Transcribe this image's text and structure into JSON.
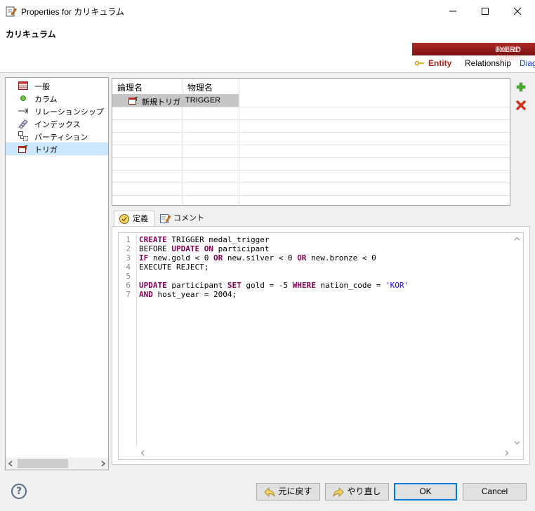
{
  "window": {
    "title": "Properties for カリキュラム"
  },
  "header": {
    "entity_name": "カリキュラム",
    "brand": {
      "exerd": "eXERD",
      "tomato": "Tomato System"
    },
    "tabs": [
      "Entity",
      "Relationship",
      "Diag"
    ]
  },
  "tree": {
    "items": [
      {
        "label": "一般",
        "icon": "table-icon"
      },
      {
        "label": "カラム",
        "icon": "column-dot-icon"
      },
      {
        "label": "リレーションシップ",
        "icon": "relationship-icon"
      },
      {
        "label": "インデックス",
        "icon": "index-icon"
      },
      {
        "label": "パーティション",
        "icon": "partition-icon"
      },
      {
        "label": "トリガ",
        "icon": "trigger-icon",
        "selected": true
      }
    ]
  },
  "grid": {
    "columns": [
      "論理名",
      "物理名"
    ],
    "rows": [
      {
        "logical": "新規トリガ",
        "physical": "TRIGGER"
      }
    ]
  },
  "tabs": [
    {
      "label": "定義",
      "icon": "definition-icon",
      "active": true
    },
    {
      "label": "コメント",
      "icon": "comment-icon",
      "active": false
    }
  ],
  "editor": {
    "line_numbers": [
      "1",
      "2",
      "3",
      "4",
      "5",
      "6",
      "7"
    ]
  },
  "buttons": {
    "undo": "元に戻す",
    "redo": "やり直し",
    "ok": "OK",
    "cancel": "Cancel",
    "help": "?"
  },
  "colors": {
    "keyword": "#7f0055",
    "string": "#2a00ff",
    "selection": "#cce8ff",
    "accent": "#0078d7",
    "brand_red": "#a01c1c"
  }
}
